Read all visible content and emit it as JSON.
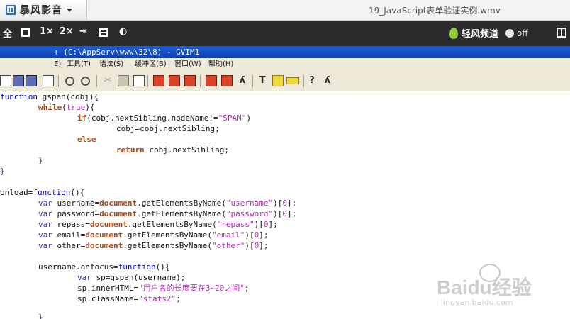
{
  "player": {
    "app_name": "暴风影音",
    "video_title": "19_JavaScript表单验证实例.wmv",
    "controls": {
      "fullscreen": "全",
      "speed1": "1×",
      "speed2": "2×",
      "qingfeng": "轻风频道",
      "toggle": "off"
    }
  },
  "vim": {
    "title": "+ (C:\\AppServ\\www\\32\\8) - GVIM1",
    "menus": [
      "E)",
      "工具(T)",
      "语法(S)",
      "缓冲区(B)",
      "窗口(W)",
      "帮助(H)"
    ],
    "code": {
      "l1a": "function",
      "l1b": " gspan(cobj){",
      "l2a": "while",
      "l2b": "(",
      "l2c": "true",
      "l2d": "){",
      "l3a": "if",
      "l3b": "(cobj.nextSibling.nodeName!=",
      "l3c": "\"SPAN\"",
      "l3d": ")",
      "l4": "cobj=cobj.nextSibling;",
      "l5": "else",
      "l6a": "return",
      "l6b": " cobj.nextSibling;",
      "l7": "}",
      "l8": "}",
      "l9a": "onload=",
      "l9b": "function",
      "l9c": "(){",
      "v1": "var",
      "v1b": " username=",
      "v1c": "document",
      "v1d": ".getElementsByName(",
      "v1e": "\"username\"",
      "v1f": ")[",
      "v1g": "0",
      "v1h": "];",
      "v2": "var",
      "v2b": " password=",
      "v2c": "document",
      "v2d": ".getElementsByName(",
      "v2e": "\"password\"",
      "v2f": ")[",
      "v2g": "0",
      "v2h": "];",
      "v3": "var",
      "v3b": " repass=",
      "v3c": "document",
      "v3d": ".getElementsByName(",
      "v3e": "\"repass\"",
      "v3f": ")[",
      "v3g": "0",
      "v3h": "];",
      "v4": "var",
      "v4b": " email=",
      "v4c": "document",
      "v4d": ".getElementsByName(",
      "v4e": "\"email\"",
      "v4f": ")[",
      "v4g": "0",
      "v4h": "];",
      "v5": "var",
      "v5b": " other=",
      "v5c": "document",
      "v5d": ".getElementsByName(",
      "v5e": "\"other\"",
      "v5f": ")[",
      "v5g": "0",
      "v5h": "];",
      "f1a": "username.onfocus=",
      "f1b": "function",
      "f1c": "(){",
      "f2a": "var",
      "f2b": " sp=gspan(username);",
      "f3a": "sp.innerHTML=",
      "f3b": "\"用户名的长度要在3~20之间\"",
      "f3c": ";",
      "f4a": "sp.className=",
      "f4b": "\"stats2\"",
      "f4c": ";",
      "f5": "}"
    }
  },
  "watermark": {
    "main": "Baidu经验",
    "url": "jingyan.baidu.com"
  },
  "colors": {
    "player_bar": "#2b2b2b",
    "vim_title": "#0a3fb4",
    "keyword": "#2e2ea8",
    "string": "#b02fb0"
  }
}
